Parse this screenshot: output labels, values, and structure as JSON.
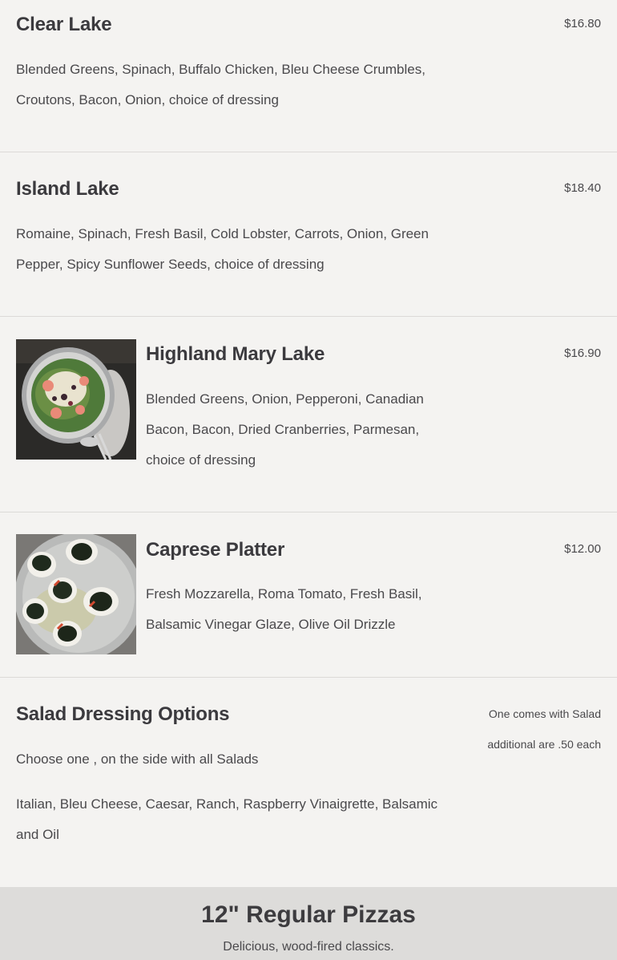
{
  "menu_items": [
    {
      "name": "Clear Lake",
      "price": "$16.80",
      "description": "Blended Greens, Spinach, Buffalo Chicken, Bleu Cheese Crumbles, Croutons, Bacon, Onion, choice of dressing"
    },
    {
      "name": "Island Lake",
      "price": "$18.40",
      "description": "Romaine, Spinach, Fresh Basil, Cold Lobster, Carrots, Onion, Green Pepper, Spicy Sunflower Seeds, choice of dressing"
    },
    {
      "name": "Highland Mary Lake",
      "price": "$16.90",
      "description": "Blended Greens, Onion, Pepperoni, Canadian Bacon, Bacon, Dried Cranberries, Parmesan, choice of dressing",
      "image": "salad-photo"
    },
    {
      "name": "Caprese Platter",
      "price": "$12.00",
      "description": "Fresh Mozzarella, Roma Tomato, Fresh Basil, Balsamic Vinegar Glaze, Olive Oil Drizzle",
      "image": "caprese-photo"
    }
  ],
  "dressing": {
    "name": "Salad Dressing Options",
    "note_line1": "One comes with Salad",
    "note_line2": "additional are .50 each",
    "subtitle": "Choose one , on the side with all Salads",
    "options": "Italian, Bleu Cheese, Caesar, Ranch, Raspberry Vinaigrette, Balsamic and Oil"
  },
  "next_section": {
    "title": "12\" Regular Pizzas",
    "subtitle": "Delicious, wood-fired classics."
  },
  "colors": {
    "background": "#f4f3f1",
    "text": "#3d3c3f",
    "footer_band": "#dddcda"
  }
}
